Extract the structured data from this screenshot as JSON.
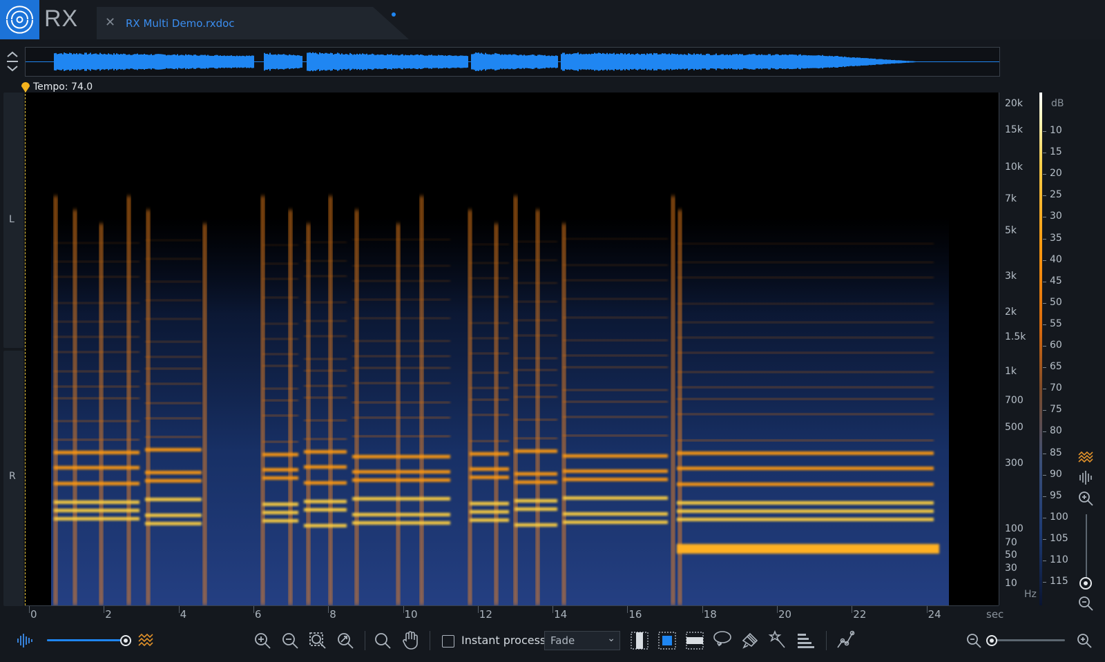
{
  "app": {
    "name": "RX"
  },
  "tab": {
    "title": "RX Multi Demo.rxdoc",
    "close_icon": "close-icon",
    "modified": true
  },
  "tempo": {
    "label": "Tempo: 74.0"
  },
  "channels": {
    "left": "L",
    "right": "R"
  },
  "freq_axis": {
    "unit": "Hz",
    "labels": [
      "20k",
      "15k",
      "10k",
      "7k",
      "5k",
      "3k",
      "2k",
      "1.5k",
      "1k",
      "700",
      "500",
      "300",
      "100",
      "70",
      "50",
      "30",
      "10"
    ]
  },
  "db_axis": {
    "unit": "dB",
    "labels": [
      "10",
      "15",
      "20",
      "25",
      "30",
      "35",
      "40",
      "45",
      "50",
      "55",
      "60",
      "65",
      "70",
      "75",
      "80",
      "85",
      "90",
      "95",
      "100",
      "105",
      "110",
      "115"
    ]
  },
  "time_axis": {
    "unit": "sec",
    "labels": [
      "0",
      "2",
      "4",
      "6",
      "8",
      "10",
      "12",
      "14",
      "16",
      "18",
      "20",
      "22",
      "24"
    ]
  },
  "toolbar": {
    "instant_process_label": "Instant process",
    "instant_process_checked": false,
    "fade_mode": "Fade",
    "selection_tool_active": "frequency-selection"
  },
  "colors": {
    "accent": "#1f86f2",
    "spectrogram_hot": "#ff9a10",
    "spectrogram_cold": "#1d3a74",
    "tempo_marker": "#f5b21c"
  }
}
